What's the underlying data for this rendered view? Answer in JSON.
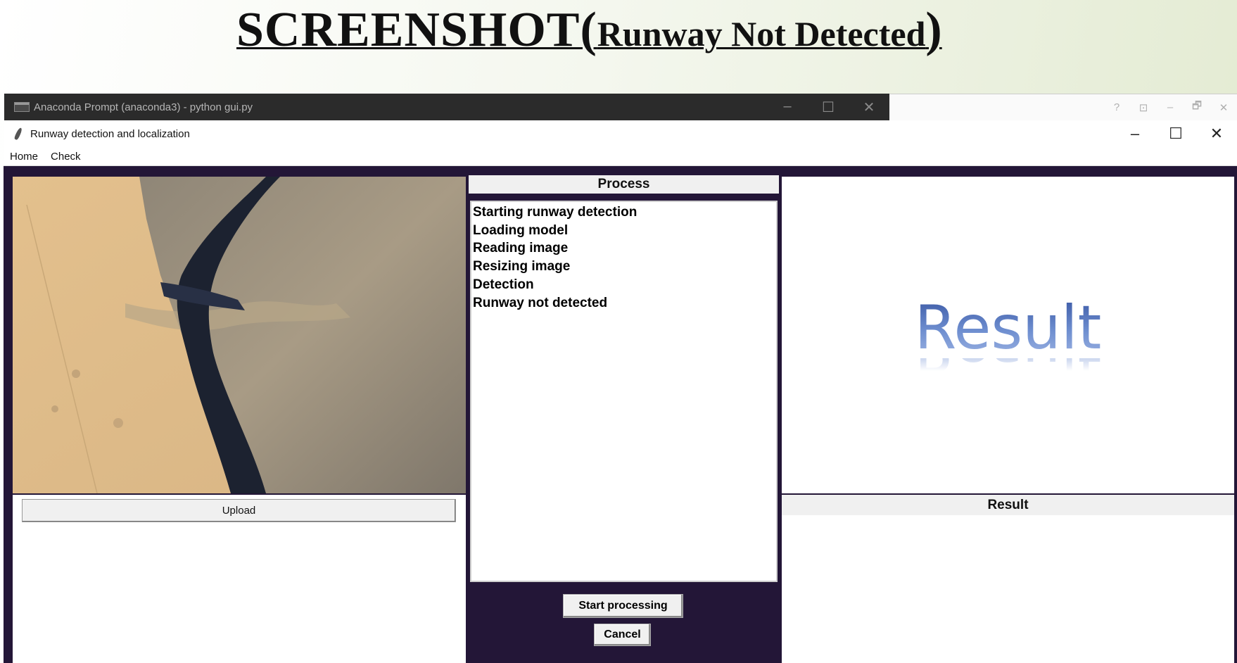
{
  "slide": {
    "title_main": "SCREENSHOT(",
    "title_sub": "Runway Not Detected",
    "title_close": ")"
  },
  "console": {
    "title": "Anaconda Prompt (anaconda3) - python  gui.py",
    "controls": [
      "–",
      "☐",
      "✕"
    ]
  },
  "background_window": {
    "controls": [
      "?",
      "⊡",
      "–",
      "🗗",
      "✕"
    ]
  },
  "app": {
    "title": "Runway detection and localization",
    "controls": [
      "–",
      "☐",
      "✕"
    ],
    "menu": [
      "Home",
      "Check"
    ]
  },
  "left_panel": {
    "upload_label": "Upload"
  },
  "process_panel": {
    "header": "Process",
    "log": [
      "Starting runway detection",
      "Loading model",
      "Reading image",
      "Resizing image",
      "Detection",
      "Runway not detected"
    ],
    "start_label": "Start processing",
    "cancel_label": "Cancel"
  },
  "result_panel": {
    "image_text": "Result",
    "header": "Result"
  },
  "colors": {
    "window_bg": "#231637",
    "result_blue": "#3c5aa6"
  }
}
